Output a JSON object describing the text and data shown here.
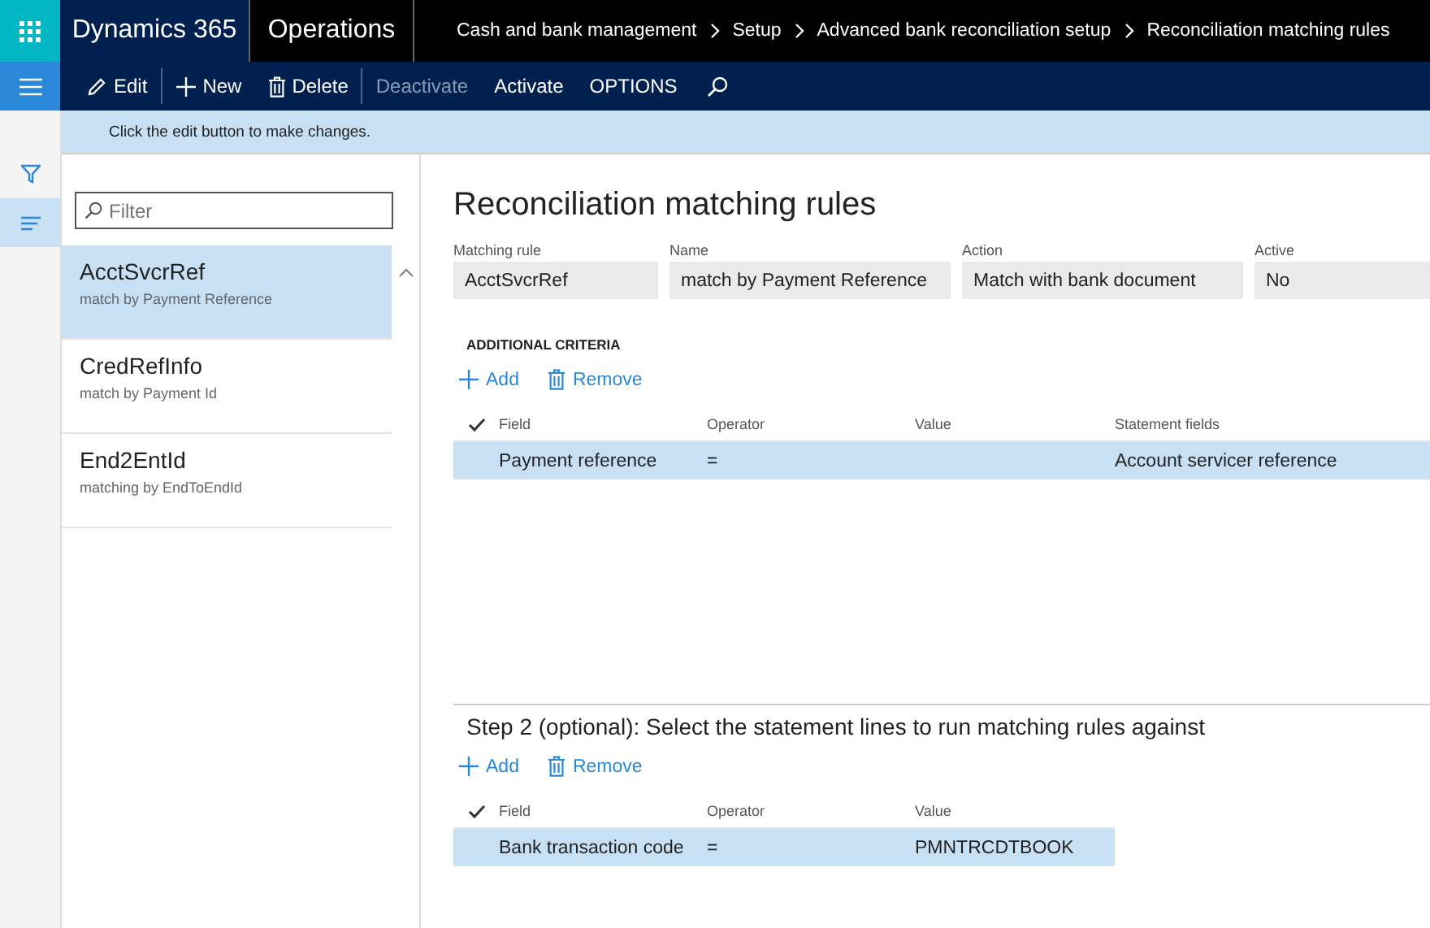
{
  "nav_bar": {
    "app_name": "Dynamics 365",
    "module": "Operations",
    "breadcrumb": [
      "Cash and bank management",
      "Setup",
      "Advanced bank reconciliation setup",
      "Reconciliation matching rules"
    ]
  },
  "action_pane": {
    "buttons": [
      {
        "label": "Edit",
        "disabled": false
      },
      {
        "label": "New",
        "disabled": false
      },
      {
        "label": "Delete",
        "disabled": false
      },
      {
        "label": "Deactivate",
        "disabled": true
      },
      {
        "label": "Activate",
        "disabled": false
      },
      {
        "label": "OPTIONS",
        "disabled": false
      }
    ]
  },
  "message_bar": {
    "text": "Click the edit button to make changes."
  },
  "side_rail": [
    {
      "kind": "filter",
      "selected": false
    },
    {
      "kind": "list",
      "selected": true
    }
  ],
  "list_pane": {
    "filter": {
      "placeholder": "Filter"
    },
    "items": [
      {
        "title": "AcctSvcrRef",
        "subtitle": "match by Payment Reference",
        "selected": true
      },
      {
        "title": "CredRefInfo",
        "subtitle": "match by Payment Id",
        "selected": false
      },
      {
        "title": "End2EntId",
        "subtitle": "matching by EndToEndId",
        "selected": false
      }
    ]
  },
  "page_title": "Reconciliation matching rules",
  "header_fields": [
    {
      "label": "Matching rule",
      "value": "AcctSvcrRef"
    },
    {
      "label": "Name",
      "value": "match by Payment Reference"
    },
    {
      "label": "Action",
      "value": "Match with bank document"
    },
    {
      "label": "Active",
      "value": "No"
    }
  ],
  "additional_criteria": {
    "heading": "ADDITIONAL CRITERIA",
    "toolbar": [
      "Add",
      "Remove"
    ],
    "columns": [
      "Field",
      "Operator",
      "Value",
      "Statement fields"
    ],
    "rows": [
      {
        "cells": [
          "Payment reference",
          "=",
          "",
          "Account servicer reference"
        ],
        "selected": true
      }
    ]
  },
  "step2": {
    "heading": "Step 2 (optional): Select the statement lines to run matching rules against",
    "toolbar": [
      "Add",
      "Remove"
    ],
    "columns": [
      "Field",
      "Operator",
      "Value"
    ],
    "rows": [
      {
        "cells": [
          "Bank transaction code",
          "=",
          "PMNTRCDTBOOK"
        ],
        "selected": true
      }
    ]
  }
}
